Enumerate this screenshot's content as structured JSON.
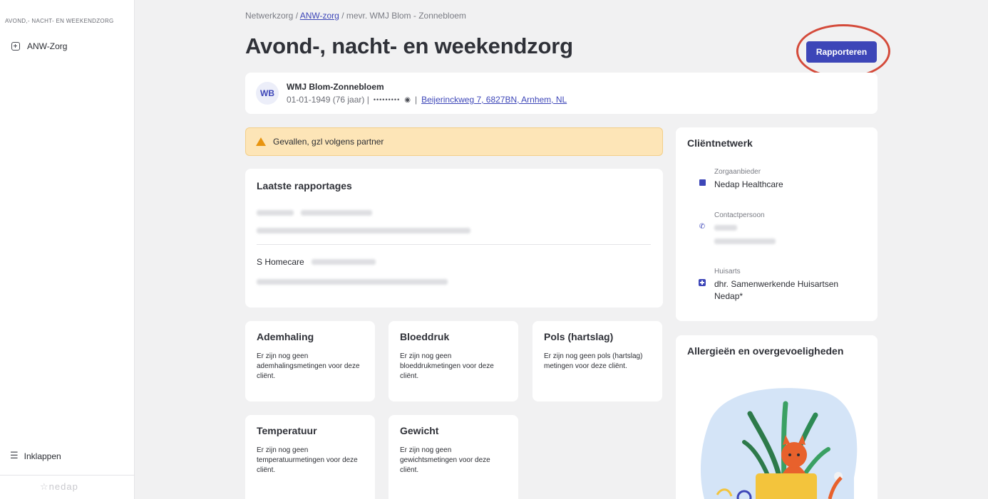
{
  "sidebar": {
    "app_name": "AVOND,- NACHT- EN WEEKENDZORG",
    "nav_item": "ANW-Zorg",
    "collapse_label": "Inklappen",
    "logo": "nedap"
  },
  "breadcrumb": {
    "root": "Netwerkzorg",
    "sep1": "/",
    "link": "ANW-zorg",
    "sep2": "/",
    "current": "mevr. WMJ Blom - Zonnebloem"
  },
  "page_title": "Avond-, nacht- en weekendzorg",
  "report_button": "Rapporteren",
  "client": {
    "initials": "WB",
    "name": "WMJ Blom-Zonnebloem",
    "birth": "01-01-1949 (76 jaar) |",
    "hidden_id": "•••••••••",
    "separator": "|",
    "address": "Beijerinckweg 7, 6827BN, Arnhem, NL"
  },
  "warning": "Gevallen, gzl volgens partner",
  "reports": {
    "title": "Laatste rapportages",
    "items": [
      {
        "author": "",
        "date": "",
        "text": ""
      },
      {
        "author": "S Homecare",
        "date": "",
        "text": ""
      }
    ]
  },
  "metrics": [
    {
      "title": "Ademhaling",
      "text": "Er zijn nog geen ademhalingsmetingen voor deze cliënt."
    },
    {
      "title": "Bloeddruk",
      "text": "Er zijn nog geen bloeddrukmetingen voor deze cliënt."
    },
    {
      "title": "Pols (hartslag)",
      "text": "Er zijn nog geen pols (hartslag) metingen voor deze cliënt."
    },
    {
      "title": "Temperatuur",
      "text": "Er zijn nog geen temperatuurmetingen voor deze cliënt."
    },
    {
      "title": "Gewicht",
      "text": "Er zijn nog geen gewichtsmetingen voor deze cliënt."
    }
  ],
  "network": {
    "title": "Cliëntnetwerk",
    "provider_label": "Zorgaanbieder",
    "provider_value": "Nedap Healthcare",
    "contact_label": "Contactpersoon",
    "gp_label": "Huisarts",
    "gp_value": "dhr. Samenwerkende Huisartsen Nedap*"
  },
  "allergies": {
    "title": "Allergieën en overgevoeligheden"
  },
  "colors": {
    "primary": "#3d46b8",
    "warning_bg": "#fde5b7",
    "highlight": "#d44a3a"
  }
}
